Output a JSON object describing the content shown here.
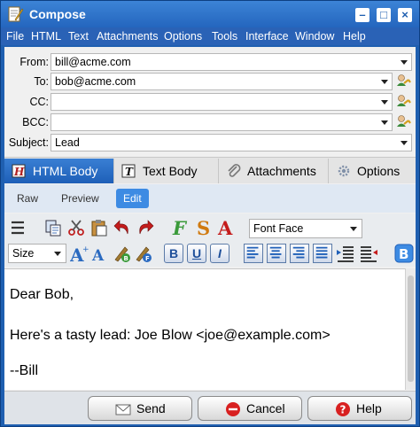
{
  "window": {
    "title": "Compose"
  },
  "menu": [
    "File",
    "HTML",
    "Text",
    "Attachments",
    "Options",
    "Tools",
    "Interface",
    "Window",
    "Help"
  ],
  "fields": {
    "from": {
      "label": "From:",
      "value": "bill@acme.com"
    },
    "to": {
      "label": "To:",
      "value": "bob@acme.com"
    },
    "cc": {
      "label": "CC:",
      "value": ""
    },
    "bcc": {
      "label": "BCC:",
      "value": ""
    },
    "subject": {
      "label": "Subject:",
      "value": "Lead"
    }
  },
  "tabs": [
    {
      "label": "HTML Body",
      "icon": "html-body-icon",
      "active": true
    },
    {
      "label": "Text Body",
      "icon": "text-body-icon",
      "active": false
    },
    {
      "label": "Attachments",
      "icon": "paperclip-icon",
      "active": false
    },
    {
      "label": "Options",
      "icon": "gear-icon",
      "active": false
    }
  ],
  "subtabs": [
    {
      "label": "Raw",
      "active": false
    },
    {
      "label": "Preview",
      "active": false
    },
    {
      "label": "Edit",
      "active": true
    }
  ],
  "toolbar": {
    "font_face": "Font Face",
    "size": "Size",
    "bold": "B",
    "underline": "U",
    "italic": "I"
  },
  "body": {
    "lines": [
      "Dear Bob,",
      "Here's a tasty lead: Joe Blow <joe@example.com>",
      "--Bill"
    ]
  },
  "buttons": {
    "send": "Send",
    "cancel": "Cancel",
    "help": "Help"
  },
  "colors": {
    "accent": "#1f5fb0",
    "active_tab": "#2a6fc9",
    "edit_active": "#3d8be3"
  }
}
